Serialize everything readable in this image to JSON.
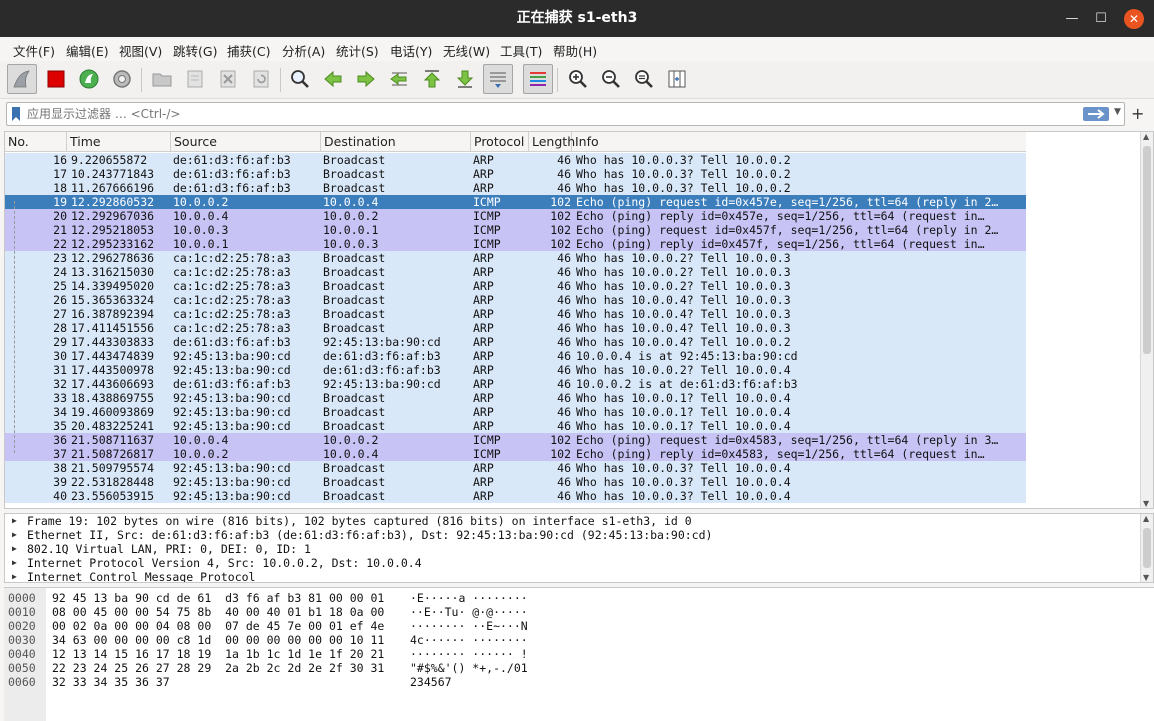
{
  "window": {
    "title": "正在捕获 s1-eth3",
    "min_glyph": "—",
    "max_glyph": "☐",
    "close_glyph": "✕"
  },
  "menu": [
    "文件(F)",
    "编辑(E)",
    "视图(V)",
    "跳转(G)",
    "捕获(C)",
    "分析(A)",
    "统计(S)",
    "电话(Y)",
    "无线(W)",
    "工具(T)",
    "帮助(H)"
  ],
  "filter": {
    "placeholder": "应用显示过滤器 … <Ctrl-/>",
    "plus": "+"
  },
  "columns": [
    "No.",
    "Time",
    "Source",
    "Destination",
    "Protocol",
    "Length",
    "Info"
  ],
  "packets": [
    {
      "no": "16",
      "time": "9.220655872",
      "src": "de:61:d3:f6:af:b3",
      "dst": "Broadcast",
      "proto": "ARP",
      "len": "46",
      "info": "Who has 10.0.0.3? Tell 10.0.0.2",
      "kind": "arp"
    },
    {
      "no": "17",
      "time": "10.243771843",
      "src": "de:61:d3:f6:af:b3",
      "dst": "Broadcast",
      "proto": "ARP",
      "len": "46",
      "info": "Who has 10.0.0.3? Tell 10.0.0.2",
      "kind": "arp"
    },
    {
      "no": "18",
      "time": "11.267666196",
      "src": "de:61:d3:f6:af:b3",
      "dst": "Broadcast",
      "proto": "ARP",
      "len": "46",
      "info": "Who has 10.0.0.3? Tell 10.0.0.2",
      "kind": "arp"
    },
    {
      "no": "19",
      "time": "12.292860532",
      "src": "10.0.0.2",
      "dst": "10.0.0.4",
      "proto": "ICMP",
      "len": "102",
      "info": "Echo (ping) request  id=0x457e, seq=1/256, ttl=64 (reply in 2…",
      "kind": "selected"
    },
    {
      "no": "20",
      "time": "12.292967036",
      "src": "10.0.0.4",
      "dst": "10.0.0.2",
      "proto": "ICMP",
      "len": "102",
      "info": "Echo (ping) reply    id=0x457e, seq=1/256, ttl=64 (request in…",
      "kind": "icmp"
    },
    {
      "no": "21",
      "time": "12.295218053",
      "src": "10.0.0.3",
      "dst": "10.0.0.1",
      "proto": "ICMP",
      "len": "102",
      "info": "Echo (ping) request  id=0x457f, seq=1/256, ttl=64 (reply in 2…",
      "kind": "icmp"
    },
    {
      "no": "22",
      "time": "12.295233162",
      "src": "10.0.0.1",
      "dst": "10.0.0.3",
      "proto": "ICMP",
      "len": "102",
      "info": "Echo (ping) reply    id=0x457f, seq=1/256, ttl=64 (request in…",
      "kind": "icmp"
    },
    {
      "no": "23",
      "time": "12.296278636",
      "src": "ca:1c:d2:25:78:a3",
      "dst": "Broadcast",
      "proto": "ARP",
      "len": "46",
      "info": "Who has 10.0.0.2? Tell 10.0.0.3",
      "kind": "arp"
    },
    {
      "no": "24",
      "time": "13.316215030",
      "src": "ca:1c:d2:25:78:a3",
      "dst": "Broadcast",
      "proto": "ARP",
      "len": "46",
      "info": "Who has 10.0.0.2? Tell 10.0.0.3",
      "kind": "arp"
    },
    {
      "no": "25",
      "time": "14.339495020",
      "src": "ca:1c:d2:25:78:a3",
      "dst": "Broadcast",
      "proto": "ARP",
      "len": "46",
      "info": "Who has 10.0.0.2? Tell 10.0.0.3",
      "kind": "arp"
    },
    {
      "no": "26",
      "time": "15.365363324",
      "src": "ca:1c:d2:25:78:a3",
      "dst": "Broadcast",
      "proto": "ARP",
      "len": "46",
      "info": "Who has 10.0.0.4? Tell 10.0.0.3",
      "kind": "arp"
    },
    {
      "no": "27",
      "time": "16.387892394",
      "src": "ca:1c:d2:25:78:a3",
      "dst": "Broadcast",
      "proto": "ARP",
      "len": "46",
      "info": "Who has 10.0.0.4? Tell 10.0.0.3",
      "kind": "arp"
    },
    {
      "no": "28",
      "time": "17.411451556",
      "src": "ca:1c:d2:25:78:a3",
      "dst": "Broadcast",
      "proto": "ARP",
      "len": "46",
      "info": "Who has 10.0.0.4? Tell 10.0.0.3",
      "kind": "arp"
    },
    {
      "no": "29",
      "time": "17.443303833",
      "src": "de:61:d3:f6:af:b3",
      "dst": "92:45:13:ba:90:cd",
      "proto": "ARP",
      "len": "46",
      "info": "Who has 10.0.0.4? Tell 10.0.0.2",
      "kind": "arp"
    },
    {
      "no": "30",
      "time": "17.443474839",
      "src": "92:45:13:ba:90:cd",
      "dst": "de:61:d3:f6:af:b3",
      "proto": "ARP",
      "len": "46",
      "info": "10.0.0.4 is at 92:45:13:ba:90:cd",
      "kind": "arp"
    },
    {
      "no": "31",
      "time": "17.443500978",
      "src": "92:45:13:ba:90:cd",
      "dst": "de:61:d3:f6:af:b3",
      "proto": "ARP",
      "len": "46",
      "info": "Who has 10.0.0.2? Tell 10.0.0.4",
      "kind": "arp"
    },
    {
      "no": "32",
      "time": "17.443606693",
      "src": "de:61:d3:f6:af:b3",
      "dst": "92:45:13:ba:90:cd",
      "proto": "ARP",
      "len": "46",
      "info": "10.0.0.2 is at de:61:d3:f6:af:b3",
      "kind": "arp"
    },
    {
      "no": "33",
      "time": "18.438869755",
      "src": "92:45:13:ba:90:cd",
      "dst": "Broadcast",
      "proto": "ARP",
      "len": "46",
      "info": "Who has 10.0.0.1? Tell 10.0.0.4",
      "kind": "arp"
    },
    {
      "no": "34",
      "time": "19.460093869",
      "src": "92:45:13:ba:90:cd",
      "dst": "Broadcast",
      "proto": "ARP",
      "len": "46",
      "info": "Who has 10.0.0.1? Tell 10.0.0.4",
      "kind": "arp"
    },
    {
      "no": "35",
      "time": "20.483225241",
      "src": "92:45:13:ba:90:cd",
      "dst": "Broadcast",
      "proto": "ARP",
      "len": "46",
      "info": "Who has 10.0.0.1? Tell 10.0.0.4",
      "kind": "arp"
    },
    {
      "no": "36",
      "time": "21.508711637",
      "src": "10.0.0.4",
      "dst": "10.0.0.2",
      "proto": "ICMP",
      "len": "102",
      "info": "Echo (ping) request  id=0x4583, seq=1/256, ttl=64 (reply in 3…",
      "kind": "icmp"
    },
    {
      "no": "37",
      "time": "21.508726817",
      "src": "10.0.0.2",
      "dst": "10.0.0.4",
      "proto": "ICMP",
      "len": "102",
      "info": "Echo (ping) reply    id=0x4583, seq=1/256, ttl=64 (request in…",
      "kind": "icmp"
    },
    {
      "no": "38",
      "time": "21.509795574",
      "src": "92:45:13:ba:90:cd",
      "dst": "Broadcast",
      "proto": "ARP",
      "len": "46",
      "info": "Who has 10.0.0.3? Tell 10.0.0.4",
      "kind": "arp"
    },
    {
      "no": "39",
      "time": "22.531828448",
      "src": "92:45:13:ba:90:cd",
      "dst": "Broadcast",
      "proto": "ARP",
      "len": "46",
      "info": "Who has 10.0.0.3? Tell 10.0.0.4",
      "kind": "arp"
    },
    {
      "no": "40",
      "time": "23.556053915",
      "src": "92:45:13:ba:90:cd",
      "dst": "Broadcast",
      "proto": "ARP",
      "len": "46",
      "info": "Who has 10.0.0.3? Tell 10.0.0.4",
      "kind": "arp"
    }
  ],
  "details": [
    "Frame 19: 102 bytes on wire (816 bits), 102 bytes captured (816 bits) on interface s1-eth3, id 0",
    "Ethernet II, Src: de:61:d3:f6:af:b3 (de:61:d3:f6:af:b3), Dst: 92:45:13:ba:90:cd (92:45:13:ba:90:cd)",
    "802.1Q Virtual LAN, PRI: 0, DEI: 0, ID: 1",
    "Internet Protocol Version 4, Src: 10.0.0.2, Dst: 10.0.0.4",
    "Internet Control Message Protocol"
  ],
  "bytes": [
    {
      "off": "0000",
      "hex": "92 45 13 ba 90 cd de 61  d3 f6 af b3 81 00 00 01",
      "ascii": "·E·····a ········"
    },
    {
      "off": "0010",
      "hex": "08 00 45 00 00 54 75 8b  40 00 40 01 b1 18 0a 00",
      "ascii": "··E··Tu· @·@·····"
    },
    {
      "off": "0020",
      "hex": "00 02 0a 00 00 04 08 00  07 de 45 7e 00 01 ef 4e",
      "ascii": "········ ··E~···N"
    },
    {
      "off": "0030",
      "hex": "34 63 00 00 00 00 c8 1d  00 00 00 00 00 00 10 11",
      "ascii": "4c······ ········"
    },
    {
      "off": "0040",
      "hex": "12 13 14 15 16 17 18 19  1a 1b 1c 1d 1e 1f 20 21",
      "ascii": "········ ······ !"
    },
    {
      "off": "0050",
      "hex": "22 23 24 25 26 27 28 29  2a 2b 2c 2d 2e 2f 30 31",
      "ascii": "\"#$%&'() *+,-./01"
    },
    {
      "off": "0060",
      "hex": "32 33 34 35 36 37",
      "ascii": "234567"
    }
  ],
  "colors": {
    "arp_row": "#d9e8f9",
    "icmp_row": "#c7c3f5",
    "selected_row": "#3c7ebc",
    "stop_capture": "#dd0000",
    "close_button": "#e95420"
  }
}
